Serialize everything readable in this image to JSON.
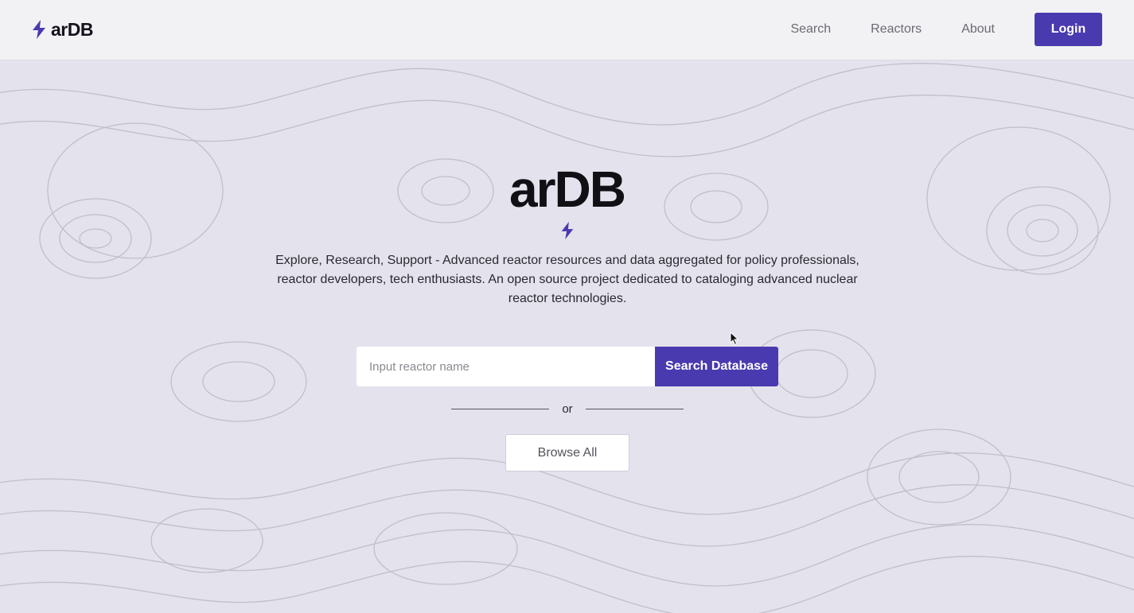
{
  "navbar": {
    "brand": "arDB",
    "links": [
      "Search",
      "Reactors",
      "About"
    ],
    "login_label": "Login"
  },
  "hero": {
    "title": "arDB",
    "description": "Explore, Research, Support - Advanced reactor resources and data aggregated for policy professionals, reactor developers, tech enthusiasts. An open source project dedicated to cataloging advanced nuclear reactor technologies.",
    "search_placeholder": "Input reactor name",
    "search_button": "Search Database",
    "divider_text": "or",
    "browse_button": "Browse All"
  },
  "colors": {
    "accent": "#4a3aaf",
    "background": "#e4e2ec",
    "navbar": "#f2f2f4"
  },
  "icons": {
    "brand_icon": "lightning-bolt-icon",
    "hero_icon": "lightning-bolt-icon",
    "cursor": "mouse-pointer-icon"
  }
}
